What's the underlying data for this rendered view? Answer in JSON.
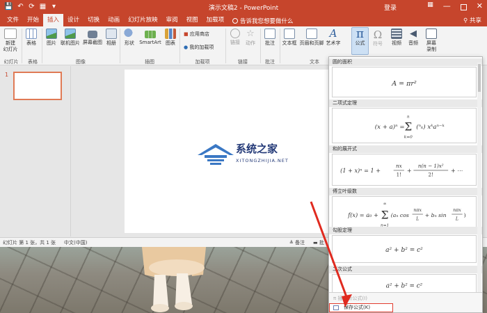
{
  "titlebar": {
    "qat": [
      "💾",
      "↶",
      "⟳",
      "▦",
      "▾"
    ],
    "title": "演示文稿2 - PowerPoint",
    "login": "登录",
    "controls": {
      "grid": "▦",
      "minimize": "—",
      "close": "✕"
    }
  },
  "tabs": [
    "文件",
    "开始",
    "插入",
    "设计",
    "切换",
    "动画",
    "幻灯片放映",
    "审阅",
    "视图",
    "加载项"
  ],
  "active_tab": "插入",
  "tellme": "告诉我您想要做什么",
  "share": "共享",
  "ribbon": {
    "new_slide": "新建\n幻灯片",
    "table": "表格",
    "picture": "图片",
    "online_picture": "联机图片",
    "screenshot": "屏幕截图",
    "album": "相册",
    "shapes": "形状",
    "smartart": "SmartArt",
    "chart": "图表",
    "store": "应用商店",
    "my_addins": "我的加载项",
    "link": "链接",
    "action": "动作",
    "comment": "批注",
    "textbox": "文本框",
    "header_footer": "页眉和页脚",
    "wordart": "艺术字",
    "equation": "公式",
    "symbol": "符号",
    "video": "视频",
    "audio": "音频",
    "screen_record": "屏幕\n录制",
    "groups": [
      "幻灯片",
      "表格",
      "图像",
      "插图",
      "加载项",
      "链接",
      "批注",
      "文本"
    ]
  },
  "slide_pane": {
    "number": "1"
  },
  "watermark": {
    "text": "系统之家",
    "sub": "XITONGZHIJIA.NET"
  },
  "statusbar": {
    "slide_info": "幻灯片 第 1 张，共 1 张",
    "language": "中文(中国)",
    "notes": "备注",
    "comments": "批"
  },
  "gallery": {
    "items": [
      {
        "category": "圆的面积",
        "formula": "A = πr²"
      },
      {
        "category": "二项式定理",
        "formula": "(x + a)ⁿ = Σ (n k) xᵏ aⁿ⁻ᵏ"
      },
      {
        "category": "和的展开式",
        "formula": "(1 + x)ⁿ = 1 + nx/1! + n(n−1)x²/2! + ⋯"
      },
      {
        "category": "傅立叶级数",
        "formula": "f(x) = a₀ + Σ (aₙ cos nπx/L + bₙ sin nπx/L)"
      },
      {
        "category": "勾股定理",
        "formula": "a² + b² = c²"
      },
      {
        "category": "二次公式",
        "formula": "a² + b² = c²"
      }
    ],
    "more": "π 插入新公式(I)",
    "save_selection": "保存公式(K)"
  }
}
